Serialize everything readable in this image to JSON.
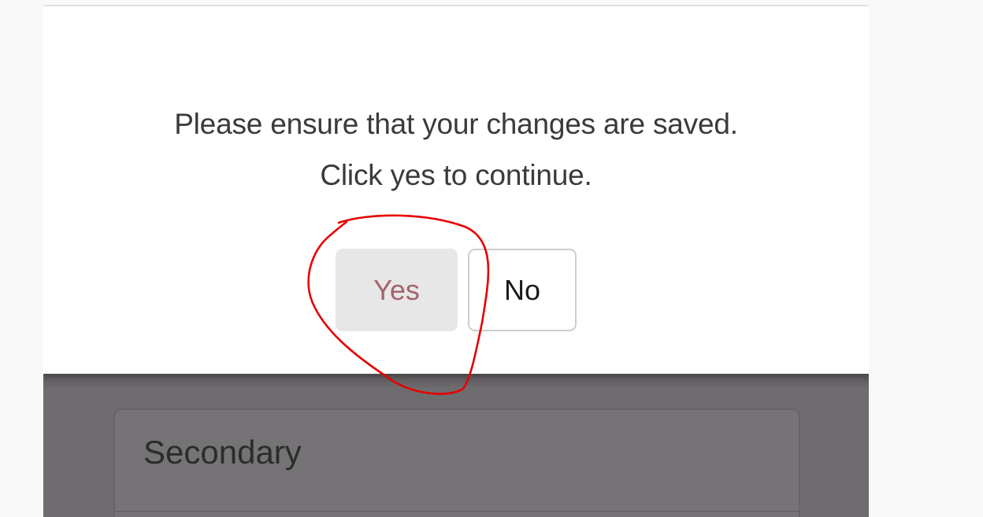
{
  "dialog": {
    "message_line1": "Please ensure that your changes are saved.",
    "message_line2": "Click yes to continue.",
    "yes_label": "Yes",
    "no_label": "No"
  },
  "background_panel": {
    "title": "Secondary"
  },
  "colors": {
    "dialog_background": "#ffffff",
    "message_text": "#3a3a3a",
    "yes_button_background": "#e8e7e8",
    "yes_button_text": "#a4646d",
    "no_button_border": "#cdcdcd",
    "overlay": "#6e6c6e",
    "annotation_circle": "#e60000"
  },
  "annotation": {
    "shape": "hand-drawn circle",
    "target": "yes-button"
  }
}
